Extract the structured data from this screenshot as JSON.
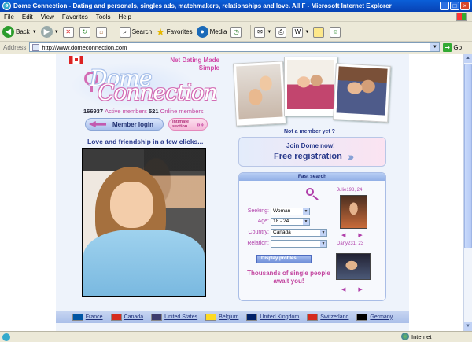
{
  "window": {
    "title": "Dome Connection - Dating and personals, singles ads, matchmakers, relationships and love. All F - Microsoft Internet Explorer"
  },
  "menu": [
    "File",
    "Edit",
    "View",
    "Favorites",
    "Tools",
    "Help"
  ],
  "toolbar": {
    "back": "Back",
    "search": "Search",
    "favorites": "Favorites",
    "media": "Media"
  },
  "address": {
    "label": "Address",
    "url": "http://www.domeconnection.com",
    "go": "Go"
  },
  "site": {
    "logo_line1": "Dome",
    "logo_line2": "Connection",
    "tagline": "Net Dating Made Simple",
    "active_count": "166937",
    "active_label": "Active members",
    "online_count": "521",
    "online_label": "Online members",
    "login_label": "Member login",
    "intimate_label": "Intimate section",
    "love_heading": "Love and friendship in a few clicks...",
    "not_member": "Not a member yet ?",
    "join_line1": "Join Dome now!",
    "join_line2": "Free registration",
    "fast_search": {
      "header": "Fast search",
      "seeking_label": "Seeking:",
      "seeking_value": "Woman",
      "age_label": "Age:",
      "age_value": "18 - 24",
      "country_label": "Country:",
      "country_value": "Canada",
      "relation_label": "Relation:",
      "relation_value": "",
      "display_btn": "Display profiles",
      "thousands": "Thousands of single people await you!",
      "profile1": "Julie198, 24",
      "profile2": "Dany231, 23"
    },
    "countries": [
      "France",
      "Canada",
      "United States",
      "Belgium",
      "United Kingdom",
      "Switzerland",
      "Germany"
    ],
    "flag_colors": [
      "#0055a4",
      "#d52b1e",
      "#3c3b6e",
      "#fdda24",
      "#012169",
      "#d52b1e",
      "#000000"
    ]
  },
  "status": {
    "zone": "Internet"
  }
}
